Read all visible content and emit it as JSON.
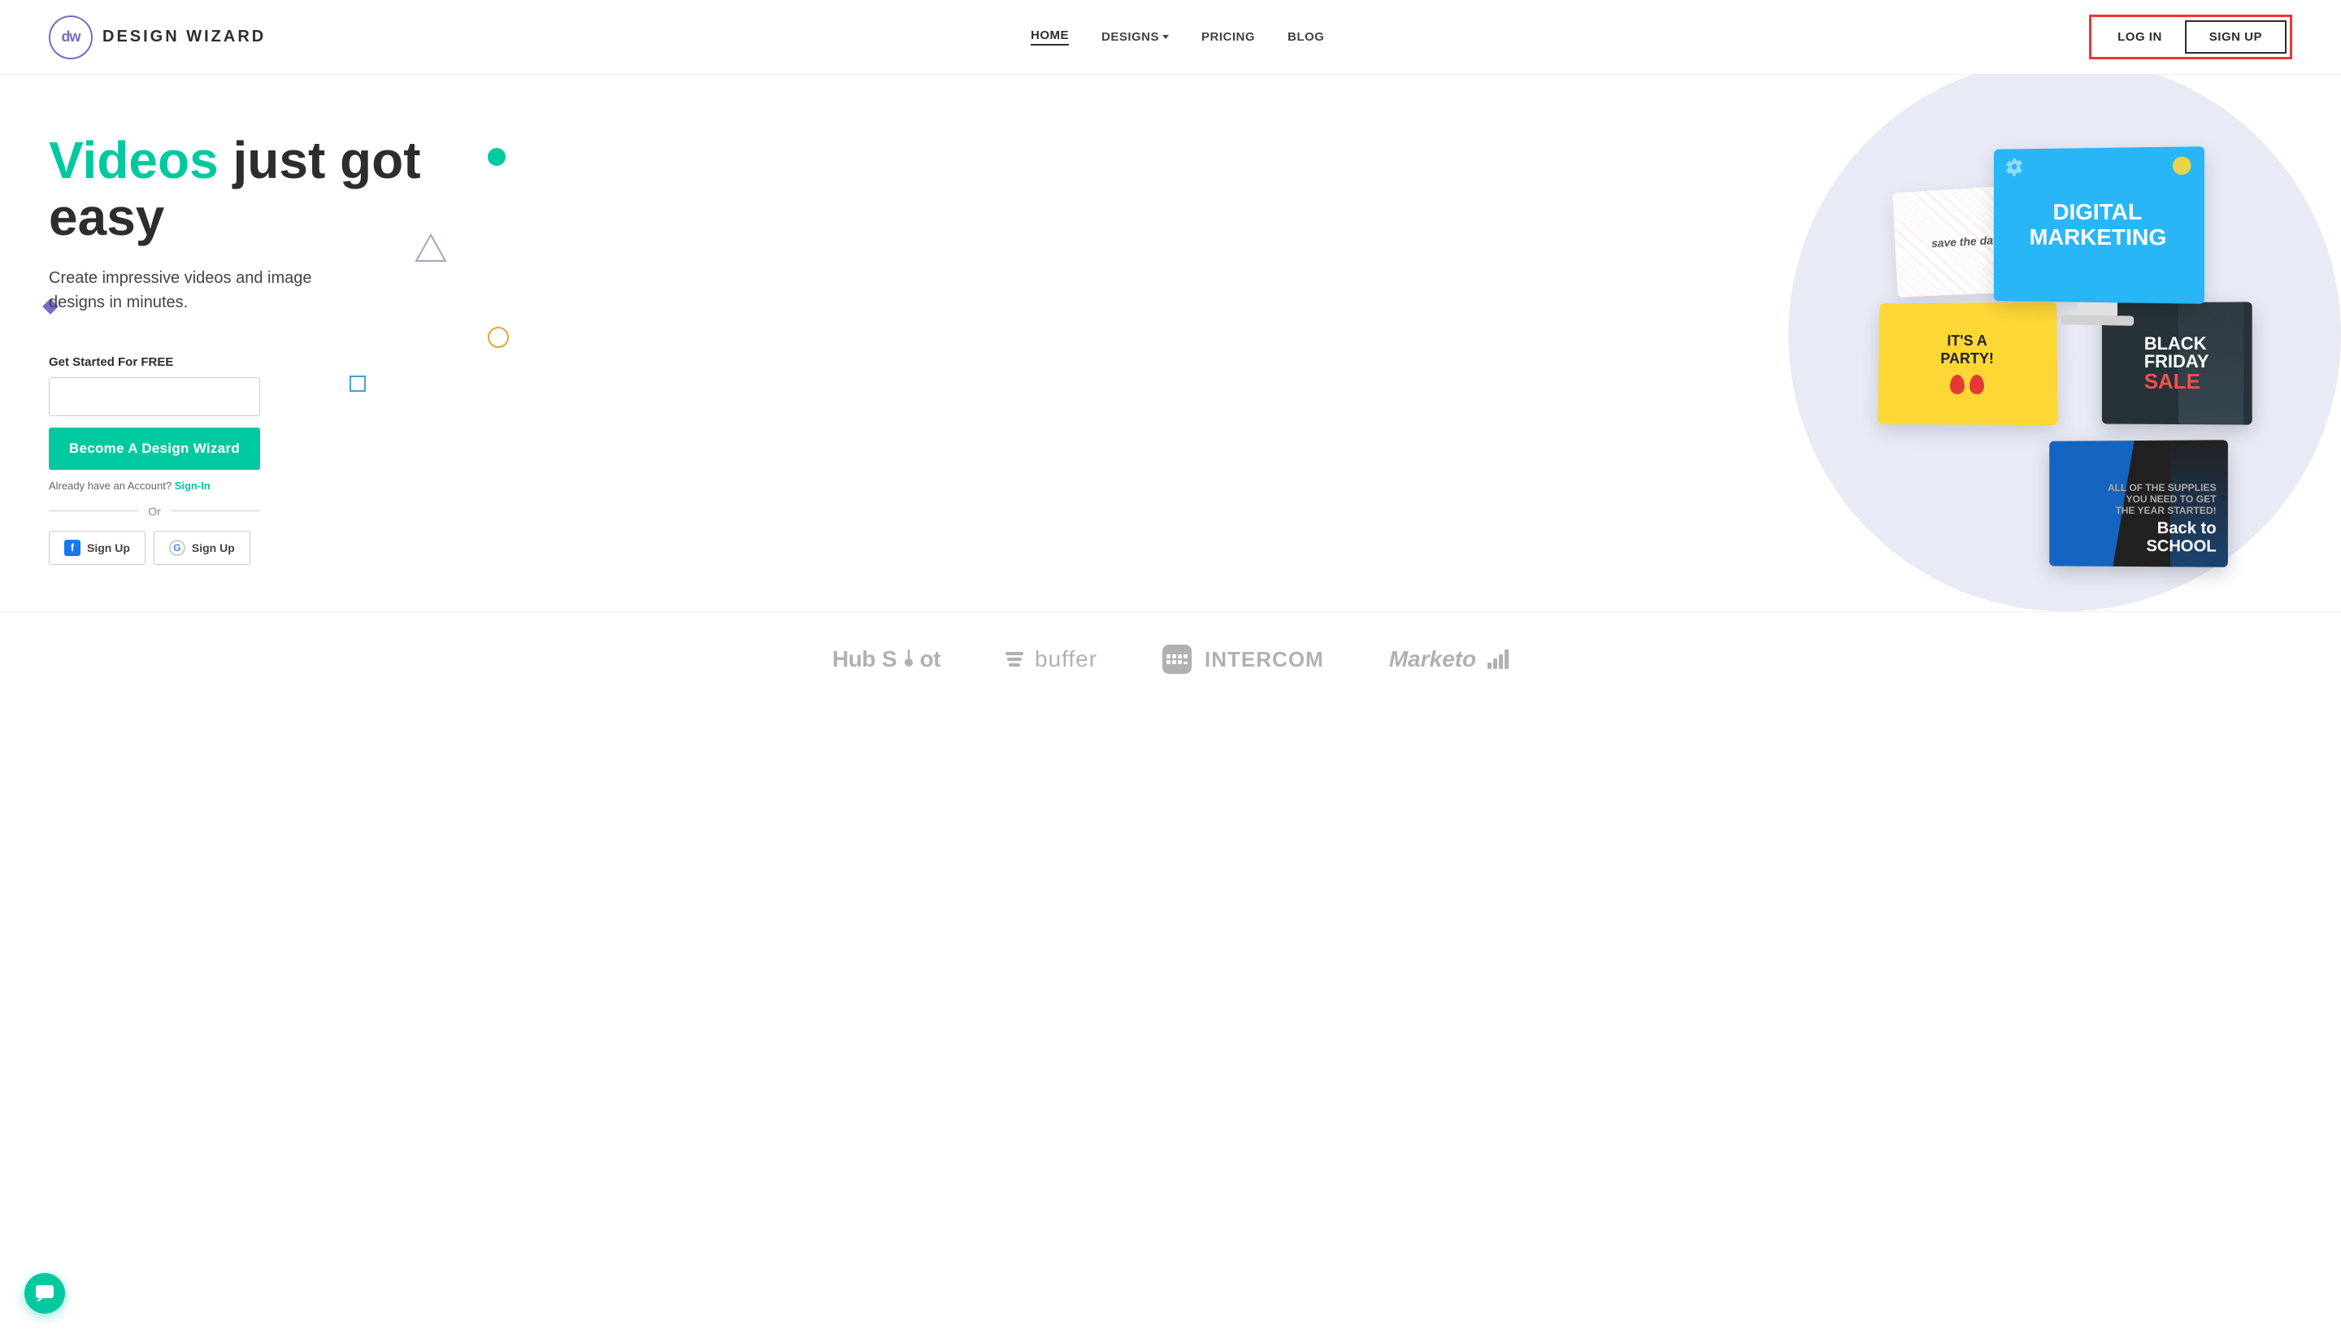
{
  "header": {
    "logo_initials": "dw",
    "logo_title": "DESIGN WIZARD",
    "nav": {
      "home": "HOME",
      "designs": "DESIGNS",
      "pricing": "PRICING",
      "blog": "BLOG"
    },
    "auth": {
      "login": "LOG IN",
      "signup": "SIGN UP"
    }
  },
  "hero": {
    "title_highlight": "Videos",
    "title_rest": " just got easy",
    "subtitle": "Create impressive videos and image\ndesigns in minutes.",
    "get_started_label": "Get Started For FREE",
    "email_placeholder": "",
    "cta_button": "Become A Design Wizard",
    "signin_prompt": "Already have an Account?",
    "signin_link": "Sign-In",
    "or_text": "Or",
    "facebook_signup": "Sign Up",
    "google_signup": "Sign Up"
  },
  "design_cards": {
    "digital_marketing": "DIGITAL\nMARKETING",
    "party": "IT'S A\nPARTY!",
    "black_friday_line1": "BLACK\nFRIDAY",
    "black_friday_line2": "SALE",
    "save_the_date": "save the date",
    "back_to_school": "Back to\nSCHOOL"
  },
  "partners": [
    {
      "name": "HubSpot",
      "type": "hubspot"
    },
    {
      "name": "buffer",
      "type": "buffer"
    },
    {
      "name": "INTERCOM",
      "type": "intercom"
    },
    {
      "name": "Marketo",
      "type": "marketo"
    }
  ],
  "colors": {
    "accent_teal": "#00c9a0",
    "dark_text": "#2d2d2d",
    "auth_border": "#e53935"
  }
}
